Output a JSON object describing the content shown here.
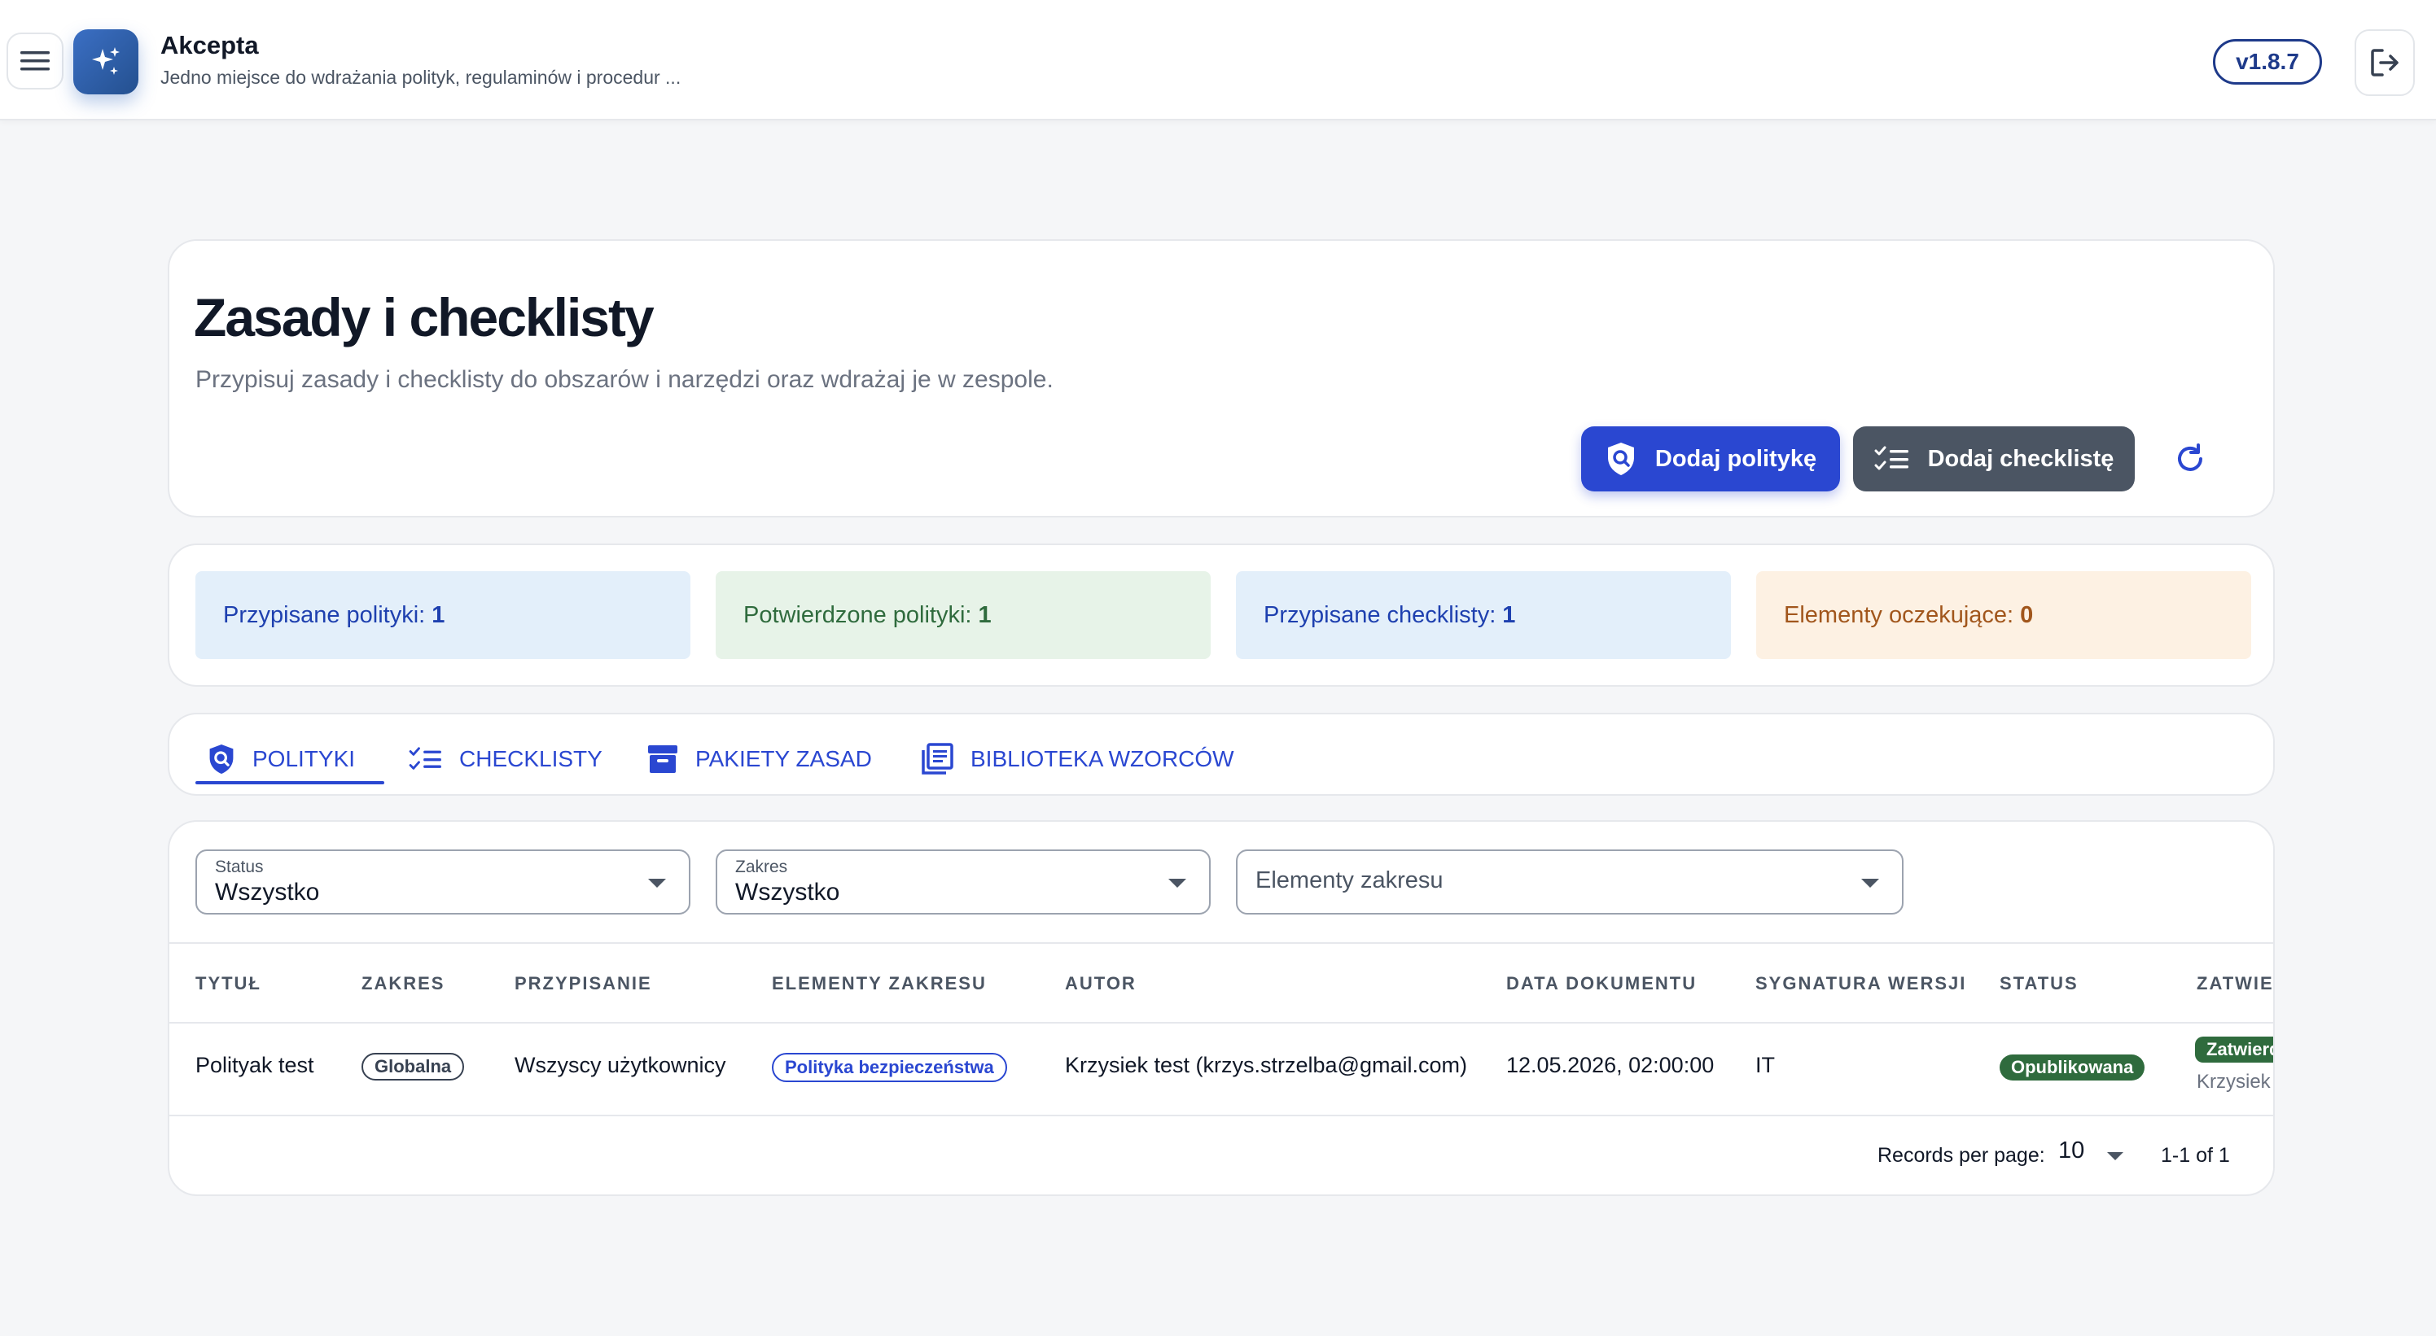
{
  "app": {
    "title": "Akcepta",
    "subtitle": "Jedno miejsce do wdrażania polityk, regulaminów i procedur ...",
    "version": "v1.8.7"
  },
  "header": {
    "title": "Zasady i checklisty",
    "subtitle": "Przypisuj zasady i checklisty do obszarów i narzędzi oraz wdrażaj je w zespole.",
    "add_policy_label": "Dodaj politykę",
    "add_checklist_label": "Dodaj checklistę"
  },
  "stats": [
    {
      "label": "Przypisane polityki:",
      "value": "1",
      "bg": "#e3effa",
      "color": "#1e40af"
    },
    {
      "label": "Potwierdzone polityki:",
      "value": "1",
      "bg": "#e7f3e8",
      "color": "#2f6b3d"
    },
    {
      "label": "Przypisane checklisty:",
      "value": "1",
      "bg": "#e3effa",
      "color": "#1e40af"
    },
    {
      "label": "Elementy oczekujące:",
      "value": "0",
      "bg": "#fdf1e3",
      "color": "#a1561c"
    }
  ],
  "tabs": [
    {
      "label": "POLITYKI",
      "icon": "shield-search-icon",
      "active": true
    },
    {
      "label": "CHECKLISTY",
      "icon": "checklist-icon"
    },
    {
      "label": "PAKIETY ZASAD",
      "icon": "archive-box-icon"
    },
    {
      "label": "BIBLIOTEKA WZORCÓW",
      "icon": "library-icon"
    }
  ],
  "filters": {
    "status": {
      "label": "Status",
      "value": "Wszystko"
    },
    "scope": {
      "label": "Zakres",
      "value": "Wszystko"
    },
    "scope_elements": {
      "placeholder": "Elementy zakresu"
    }
  },
  "table": {
    "columns": [
      "TYTUŁ",
      "ZAKRES",
      "PRZYPISANIE",
      "ELEMENTY ZAKRESU",
      "AUTOR",
      "DATA DOKUMENTU",
      "SYGNATURA WERSJI",
      "STATUS",
      "ZATWIER"
    ],
    "rows": [
      {
        "title": "Polityak test",
        "scope": "Globalna",
        "assignment": "Wszyscy użytkownicy",
        "scope_element": "Polityka bezpieczeństwa",
        "author": "Krzysiek test (krzys.strzelba@gmail.com)",
        "doc_date": "12.05.2026, 02:00:00",
        "version_sig": "IT",
        "status": "Opublikowana",
        "approved": "Zatwierd",
        "approved_by": "Krzysiek"
      }
    ]
  },
  "pagination": {
    "records_label": "Records per page:",
    "per_page": "10",
    "range": "1-1 of 1"
  },
  "colors": {
    "primary": "#2a47d1",
    "dark_button": "#4b5563",
    "published": "#2f6b3d"
  }
}
